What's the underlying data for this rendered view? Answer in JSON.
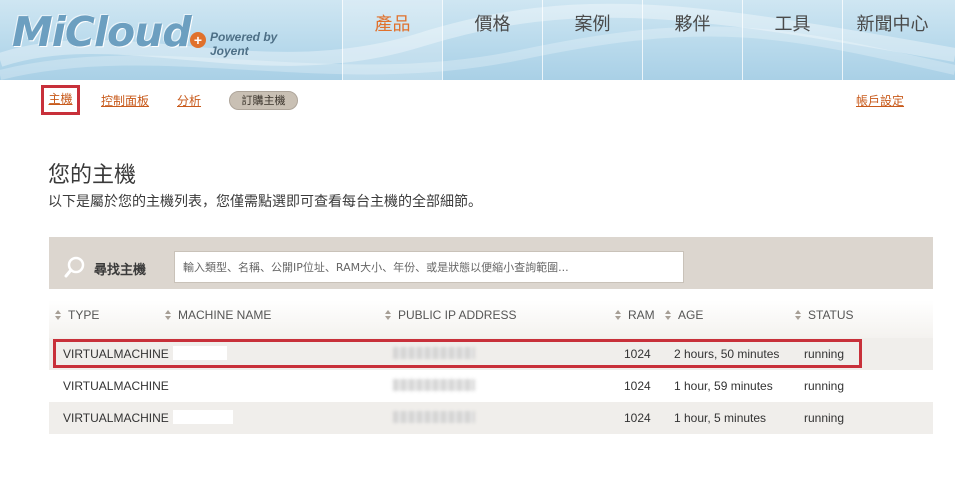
{
  "header": {
    "logo_text": "MiCloud",
    "logo_tagline": "Powered by Joyent",
    "nav": [
      {
        "label": "產品",
        "active": true
      },
      {
        "label": "價格",
        "active": false
      },
      {
        "label": "案例",
        "active": false
      },
      {
        "label": "夥伴",
        "active": false
      },
      {
        "label": "工具",
        "active": false
      },
      {
        "label": "新聞中心",
        "active": false
      }
    ]
  },
  "subnav": {
    "hosts": "主機",
    "control_panel": "控制面板",
    "analytics": "分析",
    "order_host": "訂購主機",
    "account_settings": "帳戶設定"
  },
  "page": {
    "title": "您的主機",
    "description": "以下是屬於您的主機列表，您僅需點選即可查看每台主機的全部細節。"
  },
  "search": {
    "label": "尋找主機",
    "placeholder": "輸入類型、名稱、公開IP位址、RAM大小、年份、或是狀態以便縮小查詢範圍..."
  },
  "table": {
    "columns": [
      "TYPE",
      "MACHINE NAME",
      "PUBLIC IP ADDRESS",
      "RAM",
      "AGE",
      "STATUS"
    ],
    "rows": [
      {
        "type": "VIRTUALMACHINE",
        "ram": "1024",
        "age": "2 hours, 50 minutes",
        "status": "running",
        "selected": true
      },
      {
        "type": "VIRTUALMACHINE",
        "ram": "1024",
        "age": "1 hour, 59 minutes",
        "status": "running",
        "selected": false
      },
      {
        "type": "VIRTUALMACHINE",
        "ram": "1024",
        "age": "1 hour, 5 minutes",
        "status": "running",
        "selected": false
      }
    ]
  },
  "colors": {
    "accent": "#e0712c",
    "link": "#c85a1b",
    "highlight": "#c8303a",
    "header_bg": "#b9daec",
    "search_bg": "#dcd6cf"
  }
}
